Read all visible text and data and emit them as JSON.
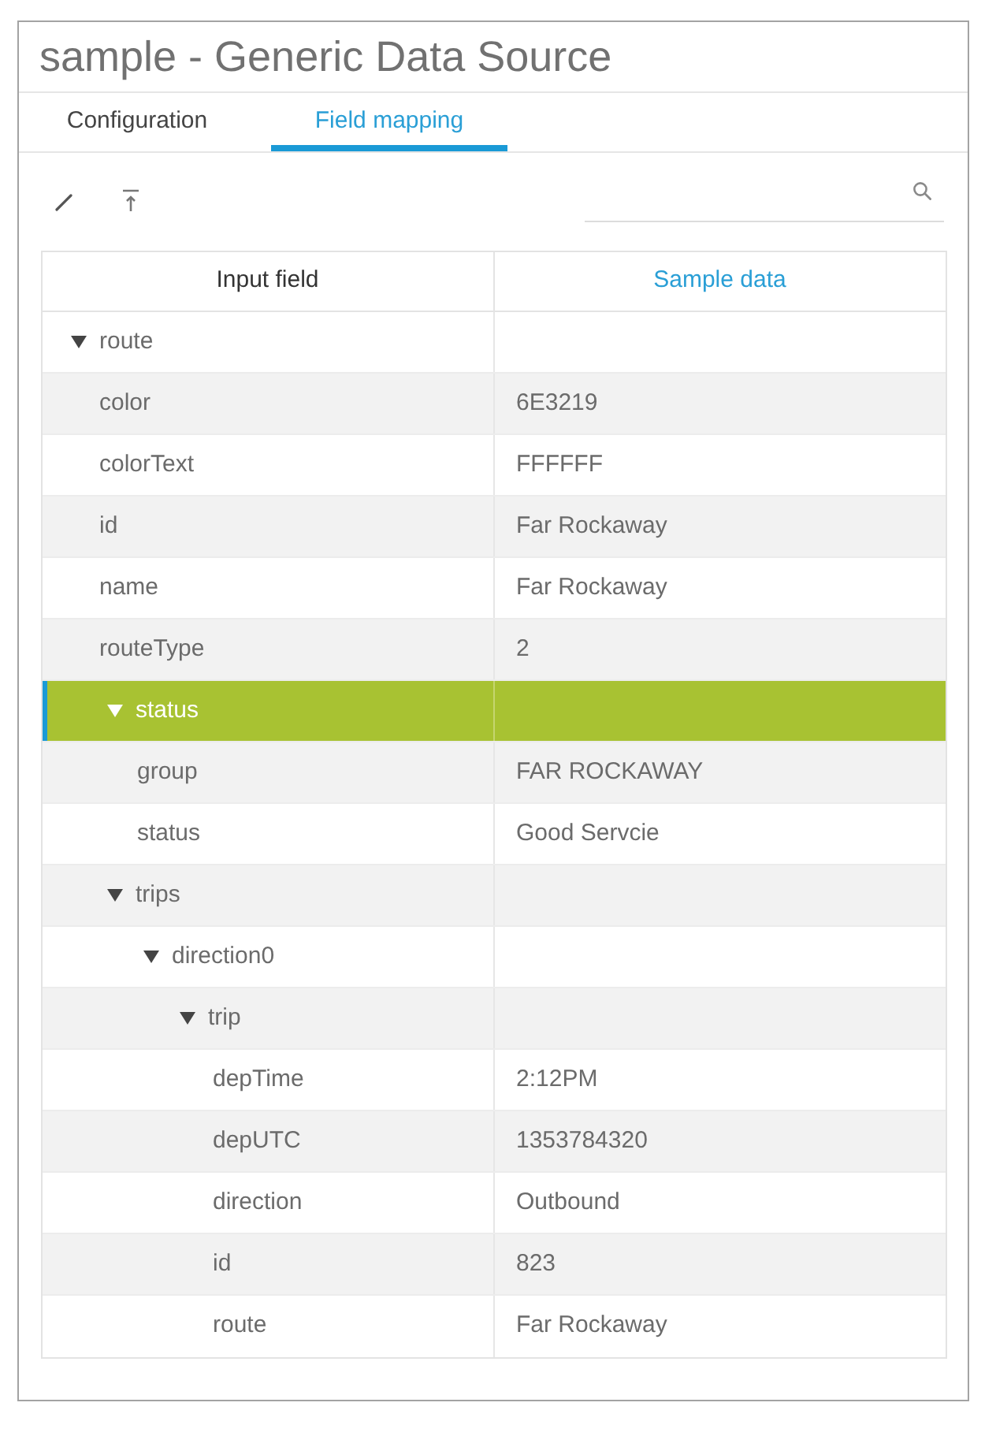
{
  "window": {
    "title": "sample - Generic Data Source"
  },
  "tabs": [
    {
      "label": "Configuration",
      "selected": false
    },
    {
      "label": "Field mapping",
      "selected": true
    }
  ],
  "table": {
    "columns": [
      {
        "label": "Input field",
        "selected": false
      },
      {
        "label": "Sample data",
        "selected": true
      }
    ],
    "rows": [
      {
        "field": "route",
        "expanded": true,
        "selected": false,
        "children": [
          {
            "field": "color",
            "value": "6E3219",
            "selected": false
          },
          {
            "field": "colorText",
            "value": "FFFFFF",
            "selected": false
          },
          {
            "field": "id",
            "value": "Far Rockaway",
            "selected": false
          },
          {
            "field": "name",
            "value": "Far Rockaway",
            "selected": false
          },
          {
            "field": "routeType",
            "value": "2",
            "selected": false
          },
          {
            "field": "status",
            "expanded": true,
            "selected": true,
            "children": [
              {
                "field": "group",
                "value": "FAR ROCKAWAY",
                "selected": false
              },
              {
                "field": "status",
                "value": "Good Servcie",
                "selected": false
              }
            ]
          },
          {
            "field": "trips",
            "expanded": true,
            "selected": false,
            "children": [
              {
                "field": "direction0",
                "expanded": true,
                "selected": false,
                "children": [
                  {
                    "field": "trip",
                    "expanded": true,
                    "selected": false,
                    "children": [
                      {
                        "field": "depTime",
                        "value": "2:12PM",
                        "selected": false
                      },
                      {
                        "field": "depUTC",
                        "value": "1353784320",
                        "selected": false
                      },
                      {
                        "field": "direction",
                        "value": "Outbound",
                        "selected": false
                      },
                      {
                        "field": "id",
                        "value": "823",
                        "selected": false
                      },
                      {
                        "field": "route",
                        "value": "Far Rockaway",
                        "selected": false
                      }
                    ]
                  }
                ]
              }
            ]
          }
        ]
      }
    ]
  }
}
